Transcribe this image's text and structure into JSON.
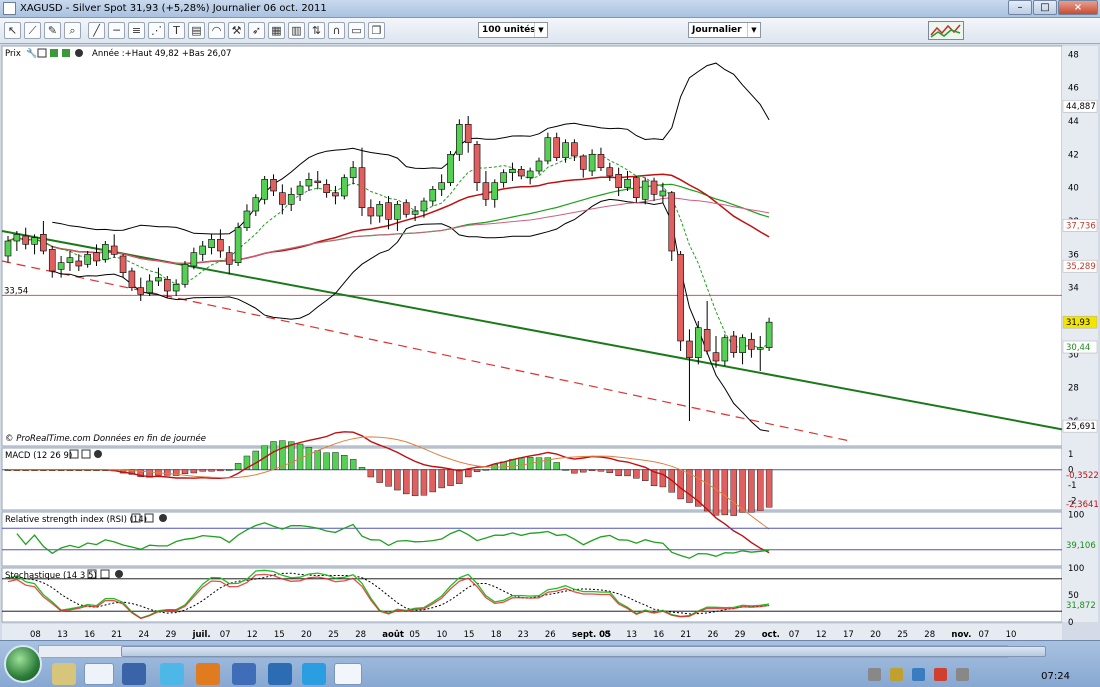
{
  "window": {
    "title": "XAGUSD - Silver Spot    31,93 (+5,28%)    Journalier  06 oct. 2011",
    "controls": [
      "–",
      "□",
      "×"
    ]
  },
  "toolbar": {
    "units_select": "100 unités",
    "period_select": "Journalier",
    "tools": [
      "cursor-icon",
      "ruler-icon",
      "zoom-icon",
      "trend-line-icon",
      "horizontal-line-icon",
      "channel-icon",
      "text-icon",
      "fibonacci-icon",
      "fan-icon",
      "rectangle-icon",
      "ellipse-icon",
      "arrow-icon",
      "eraser-icon",
      "magnet-icon",
      "grid-icon",
      "table-icon",
      "scale-icon",
      "alert-icon",
      "range-icon",
      "undo-icon",
      "copy-icon",
      "settings-icon",
      "window-icon"
    ]
  },
  "price_panel": {
    "label": "Prix",
    "annotation": "Année :+Haut 49,82 +Bas 26,07",
    "footer": "© ProRealTime.com  Données en fin de journée",
    "hline_label": "33,54",
    "axis_ticks": [
      "48",
      "46",
      "44",
      "42",
      "40",
      "38",
      "36",
      "34",
      "32",
      "30",
      "28",
      "26"
    ],
    "value_tags": [
      {
        "text": "44,887",
        "color": "#ffffff",
        "text_color": "#000000"
      },
      {
        "text": "37,736",
        "color": "#ffffff",
        "text_color": "#c0392b"
      },
      {
        "text": "35,289",
        "color": "#ffffff",
        "text_color": "#c0392b"
      },
      {
        "text": "31,93",
        "color": "#f2e600",
        "text_color": "#000000"
      },
      {
        "text": "30,44",
        "color": "#ffffff",
        "text_color": "#1a8f1a"
      },
      {
        "text": "25,691",
        "color": "#ffffff",
        "text_color": "#000000"
      }
    ]
  },
  "macd_panel": {
    "label": "MACD (12 26 9)",
    "axis_ticks": [
      "1",
      "0",
      "-1",
      "-2"
    ],
    "value_tags": [
      "-0,3522",
      "-2,3641"
    ]
  },
  "rsi_panel": {
    "label": "Relative strength index (RSI) (14)",
    "axis_ticks": [
      "100",
      "0"
    ],
    "value_tags": [
      "39,106"
    ]
  },
  "stoch_panel": {
    "label": "Stochastique (14 3 5)",
    "axis_ticks": [
      "100",
      "50",
      "0"
    ],
    "value_tags": [
      "31,872"
    ]
  },
  "xaxis": {
    "ticks": [
      "08",
      "13",
      "16",
      "21",
      "24",
      "29",
      "juil.",
      "07",
      "12",
      "15",
      "20",
      "25",
      "28",
      "août",
      "05",
      "10",
      "15",
      "18",
      "23",
      "26",
      "sept. 05",
      "08",
      "13",
      "16",
      "21",
      "26",
      "29",
      "oct.",
      "07",
      "12",
      "17",
      "20",
      "25",
      "28",
      "nov.",
      "07",
      "10"
    ]
  },
  "taskbar": {
    "clock": "07:24"
  },
  "chart_data": {
    "type": "candlestick",
    "symbol": "XAGUSD - Silver Spot",
    "title": "XAGUSD - Silver Spot    31,93 (+5,28%)    Journalier  06 oct. 2011",
    "ylim": [
      24.5,
      48.5
    ],
    "year_high": 49.82,
    "year_low": 26.07,
    "last_close": 31.93,
    "hline": 33.54,
    "candles": [
      {
        "o": 35.9,
        "h": 37.1,
        "l": 35.5,
        "c": 36.8
      },
      {
        "o": 36.8,
        "h": 37.4,
        "l": 36.2,
        "c": 37.2
      },
      {
        "o": 37.1,
        "h": 37.6,
        "l": 36.3,
        "c": 36.6
      },
      {
        "o": 36.6,
        "h": 37.2,
        "l": 36.0,
        "c": 37.0
      },
      {
        "o": 37.2,
        "h": 38.0,
        "l": 36.0,
        "c": 36.2
      },
      {
        "o": 36.3,
        "h": 36.5,
        "l": 34.6,
        "c": 35.0
      },
      {
        "o": 35.1,
        "h": 35.9,
        "l": 34.6,
        "c": 35.5
      },
      {
        "o": 35.5,
        "h": 36.2,
        "l": 35.0,
        "c": 35.8
      },
      {
        "o": 35.6,
        "h": 36.0,
        "l": 35.0,
        "c": 35.3
      },
      {
        "o": 35.4,
        "h": 36.2,
        "l": 35.2,
        "c": 36.0
      },
      {
        "o": 36.1,
        "h": 36.6,
        "l": 35.3,
        "c": 35.6
      },
      {
        "o": 35.7,
        "h": 36.8,
        "l": 35.5,
        "c": 36.6
      },
      {
        "o": 36.5,
        "h": 37.2,
        "l": 35.8,
        "c": 36.0
      },
      {
        "o": 35.9,
        "h": 36.0,
        "l": 34.6,
        "c": 34.9
      },
      {
        "o": 35.0,
        "h": 35.2,
        "l": 33.8,
        "c": 34.0
      },
      {
        "o": 34.0,
        "h": 34.6,
        "l": 33.2,
        "c": 33.6
      },
      {
        "o": 33.7,
        "h": 34.8,
        "l": 33.5,
        "c": 34.4
      },
      {
        "o": 34.4,
        "h": 35.2,
        "l": 34.1,
        "c": 34.6
      },
      {
        "o": 34.5,
        "h": 34.7,
        "l": 33.4,
        "c": 33.8
      },
      {
        "o": 33.8,
        "h": 34.5,
        "l": 33.5,
        "c": 34.2
      },
      {
        "o": 34.2,
        "h": 35.6,
        "l": 34.0,
        "c": 35.4
      },
      {
        "o": 35.3,
        "h": 36.4,
        "l": 35.1,
        "c": 36.1
      },
      {
        "o": 36.0,
        "h": 36.8,
        "l": 35.6,
        "c": 36.5
      },
      {
        "o": 36.4,
        "h": 37.2,
        "l": 36.0,
        "c": 36.9
      },
      {
        "o": 36.9,
        "h": 37.5,
        "l": 35.8,
        "c": 36.2
      },
      {
        "o": 36.1,
        "h": 36.5,
        "l": 34.8,
        "c": 35.4
      },
      {
        "o": 35.5,
        "h": 37.9,
        "l": 35.3,
        "c": 37.6
      },
      {
        "o": 37.6,
        "h": 39.0,
        "l": 37.4,
        "c": 38.6
      },
      {
        "o": 38.6,
        "h": 39.6,
        "l": 38.3,
        "c": 39.4
      },
      {
        "o": 39.3,
        "h": 40.7,
        "l": 39.0,
        "c": 40.5
      },
      {
        "o": 40.5,
        "h": 40.8,
        "l": 39.5,
        "c": 39.8
      },
      {
        "o": 39.7,
        "h": 40.2,
        "l": 38.4,
        "c": 39.0
      },
      {
        "o": 39.0,
        "h": 40.0,
        "l": 38.6,
        "c": 39.6
      },
      {
        "o": 39.6,
        "h": 40.4,
        "l": 39.2,
        "c": 40.1
      },
      {
        "o": 40.1,
        "h": 40.9,
        "l": 39.8,
        "c": 40.5
      },
      {
        "o": 40.4,
        "h": 41.0,
        "l": 39.9,
        "c": 40.3
      },
      {
        "o": 40.2,
        "h": 40.5,
        "l": 39.4,
        "c": 39.7
      },
      {
        "o": 39.7,
        "h": 40.1,
        "l": 39.0,
        "c": 39.5
      },
      {
        "o": 39.5,
        "h": 40.8,
        "l": 39.3,
        "c": 40.6
      },
      {
        "o": 40.6,
        "h": 41.6,
        "l": 40.2,
        "c": 41.2
      },
      {
        "o": 41.2,
        "h": 42.4,
        "l": 38.3,
        "c": 38.8
      },
      {
        "o": 38.8,
        "h": 39.3,
        "l": 37.8,
        "c": 38.3
      },
      {
        "o": 38.3,
        "h": 39.2,
        "l": 37.9,
        "c": 39.0
      },
      {
        "o": 39.1,
        "h": 39.5,
        "l": 37.5,
        "c": 38.1
      },
      {
        "o": 38.1,
        "h": 39.2,
        "l": 37.4,
        "c": 39.0
      },
      {
        "o": 39.1,
        "h": 39.3,
        "l": 38.2,
        "c": 38.4
      },
      {
        "o": 38.4,
        "h": 38.9,
        "l": 38.0,
        "c": 38.6
      },
      {
        "o": 38.6,
        "h": 39.4,
        "l": 38.2,
        "c": 39.2
      },
      {
        "o": 39.2,
        "h": 40.1,
        "l": 38.9,
        "c": 39.9
      },
      {
        "o": 39.9,
        "h": 40.8,
        "l": 39.5,
        "c": 40.3
      },
      {
        "o": 40.3,
        "h": 42.2,
        "l": 40.1,
        "c": 42.0
      },
      {
        "o": 42.0,
        "h": 44.1,
        "l": 41.6,
        "c": 43.8
      },
      {
        "o": 43.8,
        "h": 44.3,
        "l": 42.1,
        "c": 42.7
      },
      {
        "o": 42.6,
        "h": 42.8,
        "l": 39.8,
        "c": 40.3
      },
      {
        "o": 40.3,
        "h": 41.0,
        "l": 38.9,
        "c": 39.3
      },
      {
        "o": 39.3,
        "h": 40.5,
        "l": 38.8,
        "c": 40.3
      },
      {
        "o": 40.3,
        "h": 41.1,
        "l": 40.0,
        "c": 40.9
      },
      {
        "o": 40.9,
        "h": 41.5,
        "l": 40.4,
        "c": 41.1
      },
      {
        "o": 41.1,
        "h": 41.3,
        "l": 40.5,
        "c": 40.7
      },
      {
        "o": 40.6,
        "h": 41.2,
        "l": 40.2,
        "c": 41.0
      },
      {
        "o": 41.0,
        "h": 41.8,
        "l": 40.8,
        "c": 41.6
      },
      {
        "o": 41.6,
        "h": 43.3,
        "l": 41.4,
        "c": 43.0
      },
      {
        "o": 43.0,
        "h": 43.3,
        "l": 41.6,
        "c": 41.8
      },
      {
        "o": 41.8,
        "h": 42.9,
        "l": 41.5,
        "c": 42.7
      },
      {
        "o": 42.7,
        "h": 42.9,
        "l": 41.6,
        "c": 41.9
      },
      {
        "o": 41.9,
        "h": 42.0,
        "l": 40.6,
        "c": 41.1
      },
      {
        "o": 41.0,
        "h": 42.3,
        "l": 40.7,
        "c": 42.0
      },
      {
        "o": 42.0,
        "h": 42.4,
        "l": 41.0,
        "c": 41.2
      },
      {
        "o": 41.2,
        "h": 41.5,
        "l": 40.4,
        "c": 40.7
      },
      {
        "o": 40.8,
        "h": 41.2,
        "l": 39.5,
        "c": 40.0
      },
      {
        "o": 40.0,
        "h": 41.0,
        "l": 39.8,
        "c": 40.5
      },
      {
        "o": 40.6,
        "h": 40.7,
        "l": 39.1,
        "c": 39.4
      },
      {
        "o": 39.3,
        "h": 40.6,
        "l": 39.0,
        "c": 40.4
      },
      {
        "o": 40.4,
        "h": 40.6,
        "l": 39.2,
        "c": 39.6
      },
      {
        "o": 39.5,
        "h": 40.3,
        "l": 39.1,
        "c": 39.8
      },
      {
        "o": 39.7,
        "h": 39.8,
        "l": 35.6,
        "c": 36.2
      },
      {
        "o": 36.0,
        "h": 36.2,
        "l": 30.2,
        "c": 30.8
      },
      {
        "o": 30.8,
        "h": 31.5,
        "l": 26.0,
        "c": 29.8
      },
      {
        "o": 29.8,
        "h": 32.0,
        "l": 29.4,
        "c": 31.6
      },
      {
        "o": 31.5,
        "h": 33.2,
        "l": 30.0,
        "c": 30.2
      },
      {
        "o": 30.1,
        "h": 31.1,
        "l": 29.2,
        "c": 29.6
      },
      {
        "o": 29.6,
        "h": 31.2,
        "l": 29.3,
        "c": 31.0
      },
      {
        "o": 31.1,
        "h": 31.4,
        "l": 29.8,
        "c": 30.1
      },
      {
        "o": 30.1,
        "h": 31.2,
        "l": 29.4,
        "c": 31.0
      },
      {
        "o": 30.9,
        "h": 31.3,
        "l": 29.8,
        "c": 30.3
      },
      {
        "o": 30.3,
        "h": 31.1,
        "l": 29.0,
        "c": 30.4
      },
      {
        "o": 30.4,
        "h": 32.2,
        "l": 30.2,
        "c": 31.93
      }
    ],
    "bollinger_upper_end": 44.887,
    "bollinger_lower_end": 25.691,
    "ma_long_end": 37.736,
    "ma_medium_end": 35.289,
    "ma_short_end": 30.44,
    "trendlines": [
      "descending green support",
      "descending red dashed channel"
    ],
    "macd": {
      "macd_last": -2.3641,
      "signal_last": -0.3522,
      "ylim": [
        -2.6,
        1.4
      ]
    },
    "rsi": {
      "last": 39.106,
      "ylim": [
        0,
        100
      ]
    },
    "stochastic": {
      "last": 31.872,
      "ylim": [
        0,
        100
      ]
    }
  }
}
